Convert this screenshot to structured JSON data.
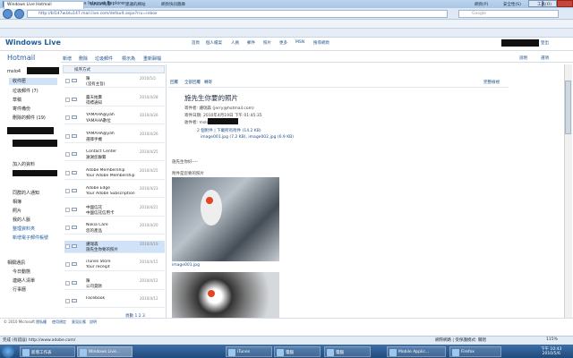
{
  "browser": {
    "window_title": "Windows Live Hotmail - Windows Internet Explorer",
    "url": "http://bl147w.blu147.mail.live.com/default.aspx?rru=inbox",
    "search_placeholder": "Google",
    "favorites_label": "我的最愛",
    "favorites": [
      "全國最優質書香",
      "Yahoo!奇摩",
      "建議的網站",
      "網頁快訊圖庫"
    ],
    "tab_title": "Windows Live Hotmail",
    "commands": [
      "網頁(P)",
      "安全性(S)",
      "工具(O)"
    ]
  },
  "hotmail": {
    "logo": "Windows Live",
    "top_links": [
      "首頁",
      "個人檔案",
      "人員",
      "郵件",
      "照片",
      "更多",
      "MSN",
      "搜尋網頁"
    ],
    "header_search_placeholder": "搜尋電子郵件",
    "right_links": [
      "說明",
      "選項",
      "登出"
    ],
    "section_title": "Hotmail",
    "account": "mslo4",
    "nav": [
      "收件匣",
      "垃圾郵件 (7)",
      "草稿",
      "寄件備份",
      "刪除的郵件 (19)"
    ],
    "nav_lower": [
      "加入的資料",
      "同群的人通知",
      "相簿",
      "照片",
      "我的人脈"
    ],
    "nav_links": [
      "整理資料夾",
      "新增電子郵件帳號"
    ],
    "nav_bottom": [
      "相關通訊",
      "今日動態",
      "連絡人清單",
      "行事曆"
    ]
  },
  "toolbar": {
    "items": [
      "新增",
      "刪除",
      "垃圾郵件",
      "標示為",
      "重新歸檔"
    ],
    "sort": "排序方式"
  },
  "messages": [
    {
      "from": "陳",
      "subject": "(沒有主旨)",
      "date": "2010/5/2"
    },
    {
      "from": "露天拍賣",
      "subject": "得標通知",
      "date": "2010/4/28"
    },
    {
      "from": "YAMAHA@yah",
      "subject": "YAMAHA數位",
      "date": "2010/4/26"
    },
    {
      "from": "YAMAHA@yah",
      "subject": "選擇手機",
      "date": "2010/4/26"
    },
    {
      "from": "Contact Center",
      "subject": "謝謝您聯繫",
      "date": "2010/4/25"
    },
    {
      "from": "Adobe Membership",
      "subject": "Your Adobe Membership",
      "date": "2010/4/25"
    },
    {
      "from": "Adobe Edge",
      "subject": "Your Adobe Subscription",
      "date": "2010/4/23"
    },
    {
      "from": "中國信託",
      "subject": "中國信託信用卡",
      "date": "2010/4/21"
    },
    {
      "from": "Nokia Care",
      "subject": "您的產品",
      "date": "2010/4/20"
    },
    {
      "from": "鍾瑞森",
      "subject": "施先生你要的照片",
      "date": "2010/4/19"
    },
    {
      "from": "iTunes Store",
      "subject": "Your receipt",
      "date": "2010/4/15"
    },
    {
      "from": "陳",
      "subject": "公司貸款",
      "date": "2010/4/12"
    },
    {
      "from": "Facebook",
      "subject": "",
      "date": "2010/4/12"
    }
  ],
  "pager": {
    "label": "頁數",
    "pages": "1 2 3"
  },
  "reading": {
    "tools": [
      "回覆",
      "全部回覆",
      "轉寄"
    ],
    "view": "完整檢視",
    "subject": "施先生你要的照片",
    "from_label": "寄件者:",
    "from": "鍾瑞森 (jerry@hotmail.com)",
    "sent_label": "寄件日期:",
    "sent": "2010年4月19日 下午 01:45:35",
    "to_label": "收件者:",
    "to": "mslo4",
    "attach": "2 個附件 | 下載所有附件 (14.2 KB)",
    "files": "image001.jpg (7.2 KB), image002.jpg (6.9 KB)",
    "body1": "施先生你好----",
    "body2": "附件是您要的照片",
    "photo_link": "image001.jpg"
  },
  "footer": [
    "© 2010 Microsoft",
    "隱私權",
    "使用規定",
    "意見反應",
    "說明"
  ],
  "status": {
    "url": "完成 (有錯誤) http://www.adobe.com/",
    "zone": "網際網路 | 受保護模式: 關閉",
    "zoom": "115%"
  },
  "taskbar": {
    "items": [
      "新增工作表",
      "Windows Live...",
      "iTunes",
      "電腦",
      "電腦",
      "Mobile Applic...",
      "Firefox"
    ],
    "time": "下午 10:43",
    "date": "2010/5/6"
  },
  "colors": {
    "accent": "#1d5d9c",
    "selection": "#cfe2f7"
  }
}
